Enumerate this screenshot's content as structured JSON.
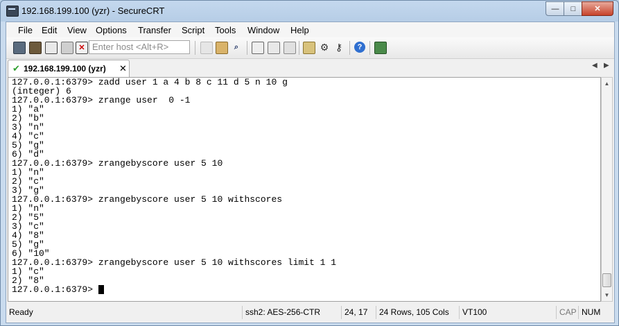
{
  "window": {
    "title": "192.168.199.100 (yzr) - SecureCRT",
    "controls": {
      "minimize": "—",
      "maximize": "□",
      "close": "✕"
    }
  },
  "menu": [
    "File",
    "Edit",
    "View",
    "Options",
    "Transfer",
    "Script",
    "Tools",
    "Window",
    "Help"
  ],
  "toolbar": {
    "host_placeholder": "Enter host <Alt+R>",
    "icons": [
      "connect-icon",
      "quick-connect-icon",
      "connect-in-tab-icon",
      "reconnect-icon",
      "disconnect-icon",
      "copy-icon",
      "paste-icon",
      "find-icon",
      "print-icon",
      "print-selection-icon",
      "print-screen-icon",
      "session-options-icon",
      "global-options-icon",
      "keymap-icon",
      "help-icon",
      "sftp-icon"
    ]
  },
  "tab": {
    "label": "192.168.199.100 (yzr)",
    "close": "✕"
  },
  "terminal": {
    "lines": [
      "127.0.0.1:6379> zadd user 1 a 4 b 8 c 11 d 5 n 10 g",
      "(integer) 6",
      "127.0.0.1:6379> zrange user  0 -1",
      "1) \"a\"",
      "2) \"b\"",
      "3) \"n\"",
      "4) \"c\"",
      "5) \"g\"",
      "6) \"d\"",
      "127.0.0.1:6379> zrangebyscore user 5 10",
      "1) \"n\"",
      "2) \"c\"",
      "3) \"g\"",
      "127.0.0.1:6379> zrangebyscore user 5 10 withscores",
      "1) \"n\"",
      "2) \"5\"",
      "3) \"c\"",
      "4) \"8\"",
      "5) \"g\"",
      "6) \"10\"",
      "127.0.0.1:6379> zrangebyscore user 5 10 withscores limit 1 1",
      "1) \"c\"",
      "2) \"8\"",
      "127.0.0.1:6379> "
    ]
  },
  "status": {
    "ready": "Ready",
    "protocol": "ssh2: AES-256-CTR",
    "position": "24,  17",
    "size": "24 Rows, 105 Cols",
    "emulation": "VT100",
    "cap": "CAP",
    "num": "NUM"
  }
}
